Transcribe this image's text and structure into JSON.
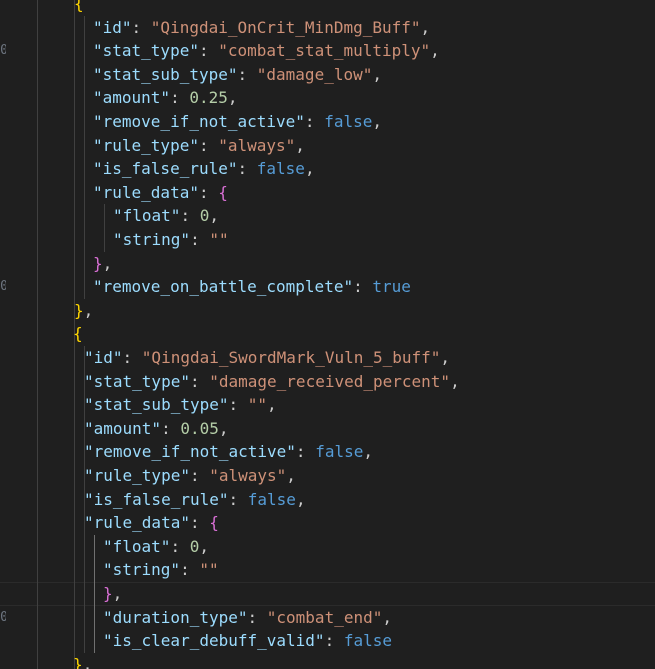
{
  "gutter_numbers": [
    "",
    "",
    "0",
    "",
    "",
    "",
    "",
    "",
    "",
    "",
    "",
    "",
    "0",
    "",
    "",
    "",
    "",
    "",
    "",
    "",
    "",
    "",
    "",
    "",
    "",
    "",
    "0",
    "",
    ""
  ],
  "lines": [
    {
      "indent": 3,
      "tokens": [
        {
          "t": "{",
          "c": "b1"
        }
      ]
    },
    {
      "indent": 4,
      "tokens": [
        {
          "t": "\"id\"",
          "c": "key"
        },
        {
          "t": ": ",
          "c": "punc"
        },
        {
          "t": "\"Qingdai_OnCrit_MinDmg_Buff\"",
          "c": "str"
        },
        {
          "t": ",",
          "c": "punc"
        }
      ]
    },
    {
      "indent": 4,
      "tokens": [
        {
          "t": "\"stat_type\"",
          "c": "key"
        },
        {
          "t": ": ",
          "c": "punc"
        },
        {
          "t": "\"combat_stat_multiply\"",
          "c": "str"
        },
        {
          "t": ",",
          "c": "punc"
        }
      ]
    },
    {
      "indent": 4,
      "tokens": [
        {
          "t": "\"stat_sub_type\"",
          "c": "key"
        },
        {
          "t": ": ",
          "c": "punc"
        },
        {
          "t": "\"damage_low\"",
          "c": "str"
        },
        {
          "t": ",",
          "c": "punc"
        }
      ]
    },
    {
      "indent": 4,
      "tokens": [
        {
          "t": "\"amount\"",
          "c": "key"
        },
        {
          "t": ": ",
          "c": "punc"
        },
        {
          "t": "0.25",
          "c": "num"
        },
        {
          "t": ",",
          "c": "punc"
        }
      ]
    },
    {
      "indent": 4,
      "tokens": [
        {
          "t": "\"remove_if_not_active\"",
          "c": "key"
        },
        {
          "t": ": ",
          "c": "punc"
        },
        {
          "t": "false",
          "c": "kw"
        },
        {
          "t": ",",
          "c": "punc"
        }
      ]
    },
    {
      "indent": 4,
      "tokens": [
        {
          "t": "\"rule_type\"",
          "c": "key"
        },
        {
          "t": ": ",
          "c": "punc"
        },
        {
          "t": "\"always\"",
          "c": "str"
        },
        {
          "t": ",",
          "c": "punc"
        }
      ]
    },
    {
      "indent": 4,
      "tokens": [
        {
          "t": "\"is_false_rule\"",
          "c": "key"
        },
        {
          "t": ": ",
          "c": "punc"
        },
        {
          "t": "false",
          "c": "kw"
        },
        {
          "t": ",",
          "c": "punc"
        }
      ]
    },
    {
      "indent": 4,
      "tokens": [
        {
          "t": "\"rule_data\"",
          "c": "key"
        },
        {
          "t": ": ",
          "c": "punc"
        },
        {
          "t": "{",
          "c": "b2"
        }
      ]
    },
    {
      "indent": 5,
      "tokens": [
        {
          "t": "\"float\"",
          "c": "key"
        },
        {
          "t": ": ",
          "c": "punc"
        },
        {
          "t": "0",
          "c": "num"
        },
        {
          "t": ",",
          "c": "punc"
        }
      ]
    },
    {
      "indent": 5,
      "tokens": [
        {
          "t": "\"string\"",
          "c": "key"
        },
        {
          "t": ": ",
          "c": "punc"
        },
        {
          "t": "\"\"",
          "c": "str"
        }
      ]
    },
    {
      "indent": 4,
      "tokens": [
        {
          "t": "}",
          "c": "b2"
        },
        {
          "t": ",",
          "c": "punc"
        }
      ]
    },
    {
      "indent": 4,
      "tokens": [
        {
          "t": "\"remove_on_battle_complete\"",
          "c": "key"
        },
        {
          "t": ": ",
          "c": "punc"
        },
        {
          "t": "true",
          "c": "kw"
        }
      ]
    },
    {
      "indent": 3,
      "tokens": [
        {
          "t": "}",
          "c": "b1"
        },
        {
          "t": ",",
          "c": "punc"
        }
      ]
    },
    {
      "indent": 3,
      "tokens": [
        {
          "t": "{",
          "c": "b1"
        }
      ]
    },
    {
      "indent": 4,
      "tokens": [
        {
          "t": "\"id\"",
          "c": "key"
        },
        {
          "t": ": ",
          "c": "punc"
        },
        {
          "t": "\"Qingdai_SwordMark_Vuln_5_buff\"",
          "c": "str"
        },
        {
          "t": ",",
          "c": "punc"
        }
      ]
    },
    {
      "indent": 4,
      "tokens": [
        {
          "t": "\"stat_type\"",
          "c": "key"
        },
        {
          "t": ": ",
          "c": "punc"
        },
        {
          "t": "\"damage_received_percent\"",
          "c": "str"
        },
        {
          "t": ",",
          "c": "punc"
        }
      ]
    },
    {
      "indent": 4,
      "tokens": [
        {
          "t": "\"stat_sub_type\"",
          "c": "key"
        },
        {
          "t": ": ",
          "c": "punc"
        },
        {
          "t": "\"\"",
          "c": "str"
        },
        {
          "t": ",",
          "c": "punc"
        }
      ]
    },
    {
      "indent": 4,
      "tokens": [
        {
          "t": "\"amount\"",
          "c": "key"
        },
        {
          "t": ": ",
          "c": "punc"
        },
        {
          "t": "0.05",
          "c": "num"
        },
        {
          "t": ",",
          "c": "punc"
        }
      ]
    },
    {
      "indent": 4,
      "tokens": [
        {
          "t": "\"remove_if_not_active\"",
          "c": "key"
        },
        {
          "t": ": ",
          "c": "punc"
        },
        {
          "t": "false",
          "c": "kw"
        },
        {
          "t": ",",
          "c": "punc"
        }
      ]
    },
    {
      "indent": 4,
      "tokens": [
        {
          "t": "\"rule_type\"",
          "c": "key"
        },
        {
          "t": ": ",
          "c": "punc"
        },
        {
          "t": "\"always\"",
          "c": "str"
        },
        {
          "t": ",",
          "c": "punc"
        }
      ]
    },
    {
      "indent": 4,
      "tokens": [
        {
          "t": "\"is_false_rule\"",
          "c": "key"
        },
        {
          "t": ": ",
          "c": "punc"
        },
        {
          "t": "false",
          "c": "kw"
        },
        {
          "t": ",",
          "c": "punc"
        }
      ]
    },
    {
      "indent": 4,
      "tokens": [
        {
          "t": "\"rule_data\"",
          "c": "key"
        },
        {
          "t": ": ",
          "c": "punc"
        },
        {
          "t": "{",
          "c": "b2"
        }
      ]
    },
    {
      "indent": 5,
      "tokens": [
        {
          "t": "\"float\"",
          "c": "key"
        },
        {
          "t": ": ",
          "c": "punc"
        },
        {
          "t": "0",
          "c": "num"
        },
        {
          "t": ",",
          "c": "punc"
        }
      ]
    },
    {
      "indent": 5,
      "tokens": [
        {
          "t": "\"string\"",
          "c": "key"
        },
        {
          "t": ": ",
          "c": "punc"
        },
        {
          "t": "\"\"",
          "c": "str"
        }
      ]
    },
    {
      "indent": 5,
      "tokens": [
        {
          "t": "}",
          "c": "b2"
        },
        {
          "t": ",",
          "c": "punc"
        }
      ],
      "current": true
    },
    {
      "indent": 5,
      "tokens": [
        {
          "t": "\"duration_type\"",
          "c": "key"
        },
        {
          "t": ": ",
          "c": "punc"
        },
        {
          "t": "\"combat_end\"",
          "c": "str"
        },
        {
          "t": ",",
          "c": "punc"
        }
      ]
    },
    {
      "indent": 5,
      "tokens": [
        {
          "t": "\"is_clear_debuff_valid\"",
          "c": "key"
        },
        {
          "t": ": ",
          "c": "punc"
        },
        {
          "t": "false",
          "c": "kw"
        }
      ]
    },
    {
      "indent": 3,
      "tokens": [
        {
          "t": "}",
          "c": "b1"
        },
        {
          "t": ",",
          "c": "punc"
        }
      ]
    }
  ]
}
